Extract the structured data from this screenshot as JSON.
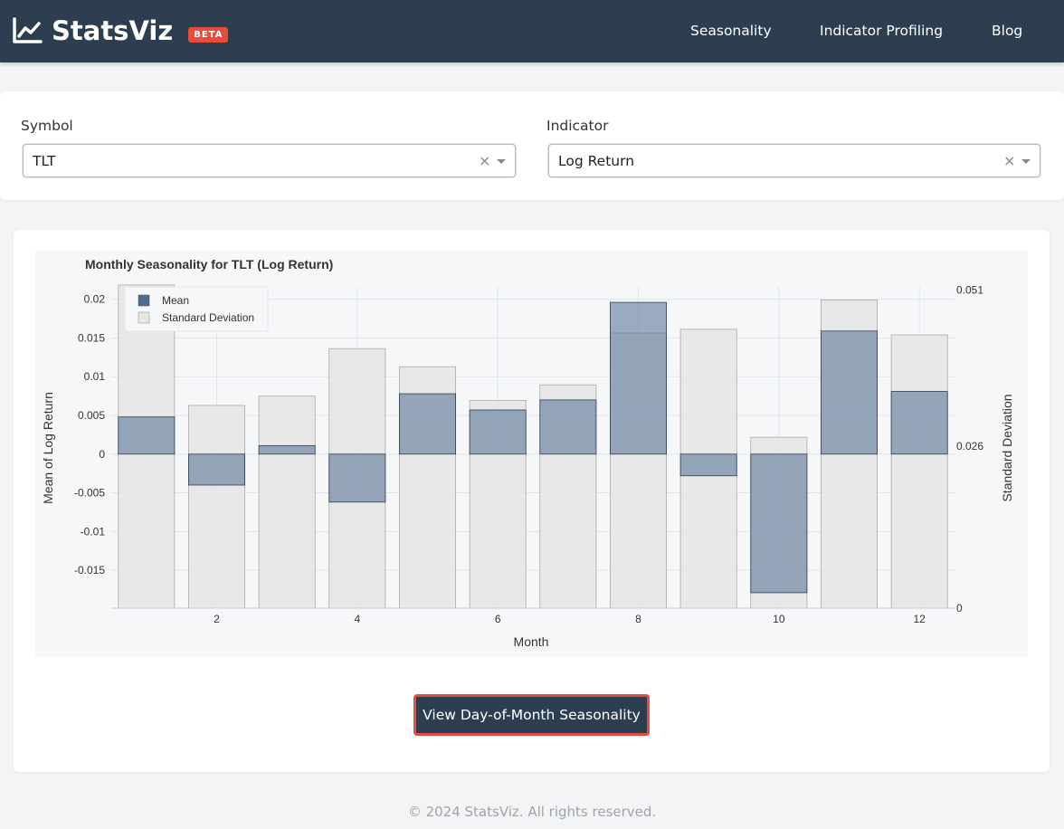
{
  "brand": {
    "name": "StatsViz",
    "badge": "BETA",
    "icon": "chart-line-icon"
  },
  "nav": {
    "items": [
      "Seasonality",
      "Indicator Profiling",
      "Blog"
    ]
  },
  "filters": {
    "symbol": {
      "label": "Symbol",
      "value": "TLT"
    },
    "indicator": {
      "label": "Indicator",
      "value": "Log Return"
    },
    "clear_glyph": "×"
  },
  "chart_data": {
    "type": "bar",
    "title": "Monthly Seasonality for TLT (Log Return)",
    "xlabel": "Month",
    "ylabel": "Mean of Log Return",
    "y2label": "Standard Deviation",
    "categories": [
      1,
      2,
      3,
      4,
      5,
      6,
      7,
      8,
      9,
      10,
      11,
      12
    ],
    "xticks": [
      2,
      4,
      6,
      8,
      10,
      12
    ],
    "yticks": [
      0.02,
      0.015,
      0.01,
      0.005,
      0,
      -0.005,
      -0.01,
      -0.015
    ],
    "ytick_labels": [
      "0.02",
      "0.015",
      "0.01",
      "0.005",
      "0",
      "-0.005",
      "-0.01",
      "-0.015"
    ],
    "y2ticks": [
      0.051,
      0.026,
      0
    ],
    "y2tick_labels": [
      "0.051",
      "0.026",
      "0"
    ],
    "ylim": [
      -0.0199,
      0.0216
    ],
    "y2lim": [
      0,
      0.0515
    ],
    "series": [
      {
        "name": "Mean",
        "axis": "y",
        "color": "#4f6d93",
        "values": [
          0.0048,
          -0.004,
          0.0011,
          -0.0062,
          0.0078,
          0.0057,
          0.007,
          0.0196,
          -0.0028,
          -0.0179,
          0.0159,
          0.0081
        ]
      },
      {
        "name": "Standard Deviation",
        "axis": "y2",
        "color": "#e6e6e6",
        "values": [
          0.0518,
          0.0325,
          0.034,
          0.0416,
          0.0387,
          0.0333,
          0.0358,
          0.0441,
          0.0447,
          0.0274,
          0.0494,
          0.0438
        ]
      }
    ],
    "legend": "top-left",
    "grid": true
  },
  "actions": {
    "day_of_month_label": "View Day-of-Month Seasonality"
  },
  "footer": {
    "text": "© 2024 StatsViz. All rights reserved."
  }
}
